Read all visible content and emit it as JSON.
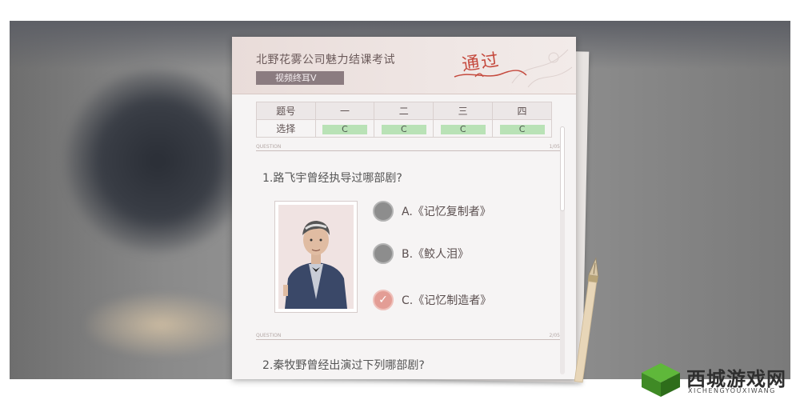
{
  "exam": {
    "title": "北野花雾公司魅力结课考试",
    "subtitle": "视频终耳V",
    "stamp": "通过"
  },
  "answer_table": {
    "row_headers": [
      "题号",
      "选择"
    ],
    "columns": [
      "一",
      "二",
      "三",
      "四"
    ],
    "answers": [
      "C",
      "C",
      "C",
      "C"
    ]
  },
  "dividers": {
    "tag": "QUESTION",
    "page_1": "1/05",
    "page_2": "2/05"
  },
  "question1": {
    "text": "1.路飞宇曾经执导过哪部剧?",
    "options": [
      "A.《记忆复制者》",
      "B.《鲛人泪》",
      "C.《记忆制造者》"
    ],
    "selected_index": 2
  },
  "question2": {
    "text": "2.秦牧野曾经出演过下列哪部剧?"
  },
  "watermark": {
    "name": "西城游戏网",
    "pinyin": "XICHENGYOUXIWANG"
  },
  "colors": {
    "stamp": "#c54a3e",
    "answer_highlight": "#b9e2b6",
    "selected_option": "#e39d95",
    "unselected_option": "#8d8d8d"
  }
}
